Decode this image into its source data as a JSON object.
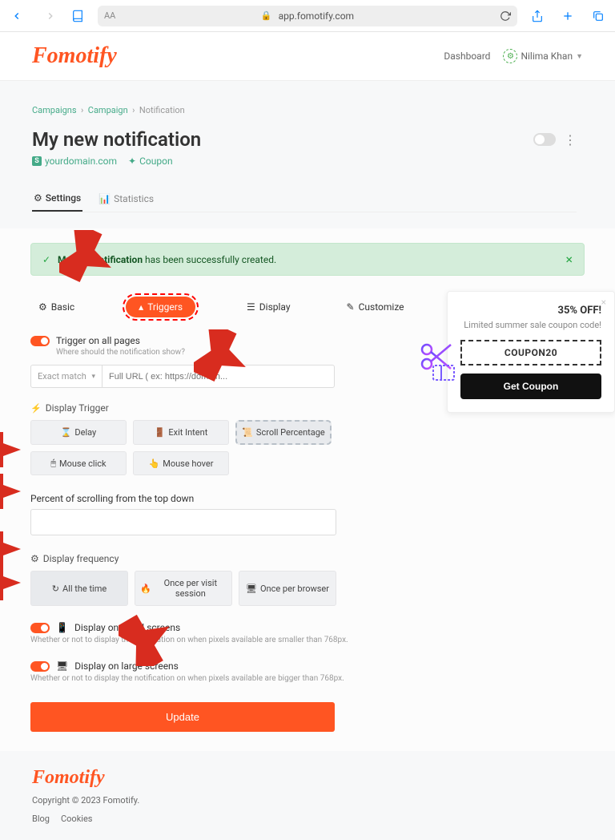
{
  "browser": {
    "url": "app.fomotify.com",
    "text_size": "AA"
  },
  "header": {
    "brand": "Fomotify",
    "dashboard": "Dashboard",
    "user": "Nilima Khan"
  },
  "breadcrumb": {
    "a": "Campaigns",
    "b": "Campaign",
    "c": "Notification"
  },
  "page": {
    "title": "My new notification",
    "domain": "yourdomain.com",
    "type": "Coupon"
  },
  "tabs": {
    "settings": "Settings",
    "statistics": "Statistics"
  },
  "alert": {
    "text": "My new notification has been successfully created."
  },
  "section_tabs": {
    "basic": "Basic",
    "triggers": "Triggers",
    "display": "Display",
    "customize": "Customize"
  },
  "triggers": {
    "all_pages_label": "Trigger on all pages",
    "all_pages_helper": "Where should the notification show?",
    "match_select": "Exact match",
    "url_placeholder": "Full URL ( ex: https://domain...",
    "display_trigger_label": "Display Trigger",
    "opts": {
      "delay": "Delay",
      "exit": "Exit Intent",
      "scroll": "Scroll Percentage",
      "click": "Mouse click",
      "hover": "Mouse hover"
    },
    "percent_label": "Percent of scrolling from the top down",
    "freq_label": "Display frequency",
    "freq": {
      "all": "All the time",
      "session": "Once per visit session",
      "browser": "Once per browser"
    },
    "small_label": "Display on small screens",
    "small_helper": "Whether or not to display the notification on when pixels available are smaller than 768px.",
    "large_label": "Display on large screens",
    "large_helper": "Whether or not to display the notification on when pixels available are bigger than 768px.",
    "update": "Update"
  },
  "promo": {
    "title": "35% OFF!",
    "sub": "Limited summer sale coupon code!",
    "code": "COUPON20",
    "cta": "Get Coupon"
  },
  "footer": {
    "brand": "Fomotify",
    "copyright": "Copyright © 2023 Fomotify.",
    "blog": "Blog",
    "cookies": "Cookies"
  }
}
